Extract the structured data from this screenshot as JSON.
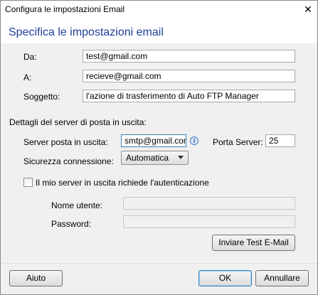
{
  "window": {
    "title": "Configura le impostazioni Email",
    "close_glyph": "✕"
  },
  "header": {
    "title": "Specifica le impostazioni email"
  },
  "form": {
    "from_label": "Da:",
    "from_value": "test@gmail.com",
    "to_label": "A:",
    "to_value": "recieve@gmail.com",
    "subject_label": "Soggetto:",
    "subject_value": "l'azione di trasferimento di Auto FTP Manager"
  },
  "server": {
    "section_label": "Dettagli del server di posta in uscita:",
    "server_label": "Server posta in uscita:",
    "server_value": "smtp@gmail.com",
    "info_glyph": "i",
    "port_label": "Porta Server:",
    "port_value": "25",
    "security_label": "Sicurezza connessione:",
    "security_value": "Automatica",
    "auth_label": "Il mio server in uscita richiede l'autenticazione",
    "username_label": "Nome utente:",
    "username_value": "",
    "password_label": "Password:",
    "password_value": "",
    "test_button": "Inviare Test E-Mail"
  },
  "footer": {
    "help_button": "Aiuto",
    "ok_button": "OK",
    "cancel_button": "Annullare"
  }
}
